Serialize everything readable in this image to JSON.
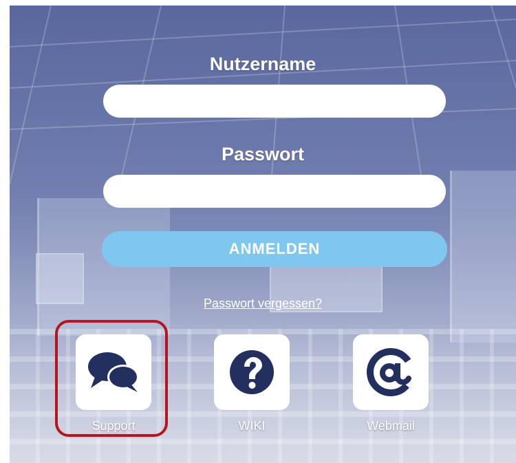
{
  "login": {
    "username_label": "Nutzername",
    "username_value": "",
    "password_label": "Passwort",
    "password_value": "",
    "submit_label": "ANMELDEN",
    "forgot_link": "Passwort vergessen?"
  },
  "tiles": [
    {
      "label": "Support",
      "icon": "chat-bubbles-icon"
    },
    {
      "label": "WIKI",
      "icon": "question-circle-icon"
    },
    {
      "label": "Webmail",
      "icon": "at-sign-icon"
    }
  ],
  "colors": {
    "accent_button": "#7fc7ee",
    "icon_navy": "#23305f",
    "highlight_red": "#b4161c"
  }
}
